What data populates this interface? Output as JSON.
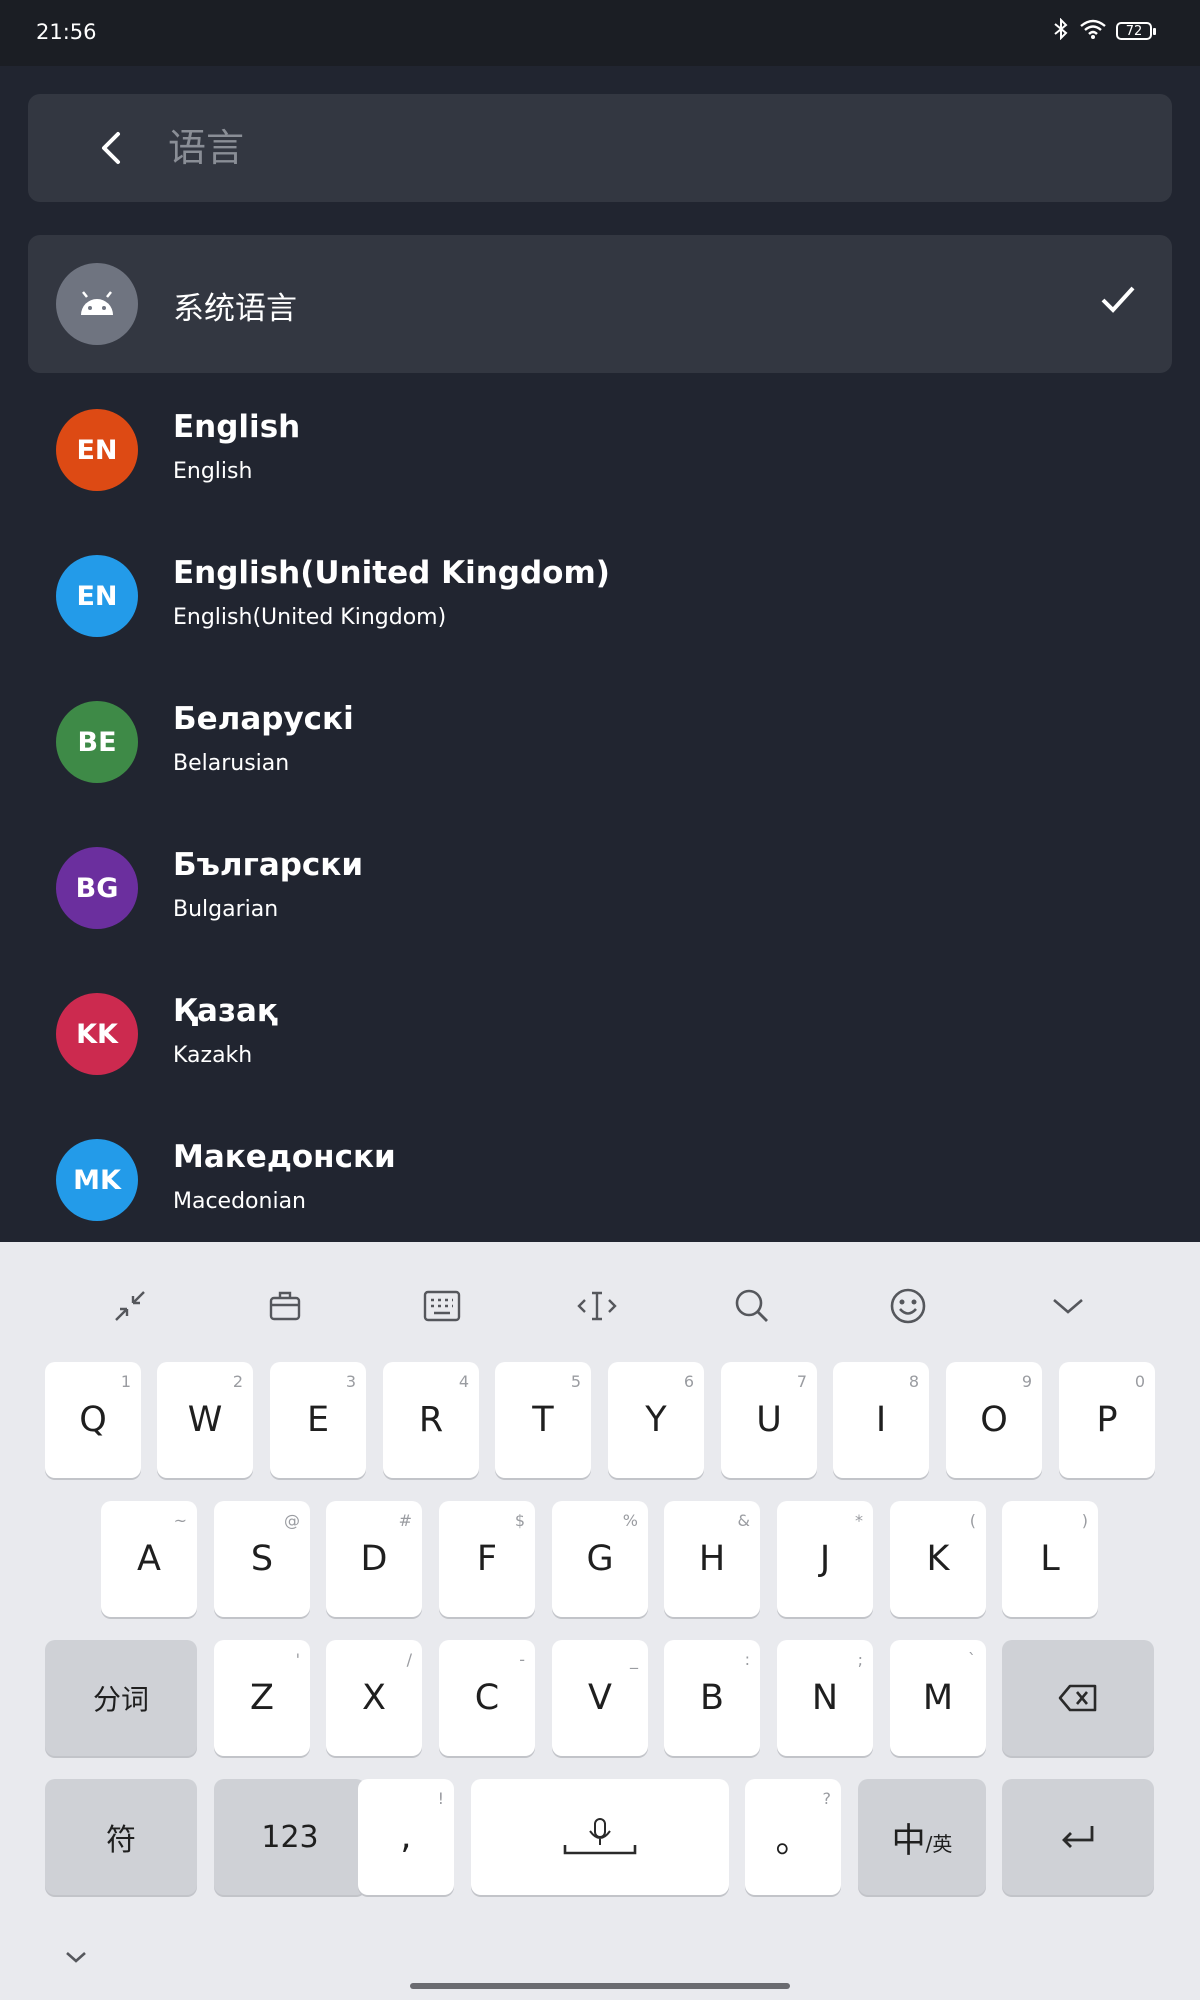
{
  "status_bar": {
    "time": "21:56",
    "battery": "72"
  },
  "search": {
    "query": "语言"
  },
  "languages": [
    {
      "title": "系统语言",
      "subtitle": "",
      "avatar_text": "",
      "avatar_color": "#6f7480",
      "selected": true
    },
    {
      "title": "English",
      "subtitle": "English",
      "avatar_text": "EN",
      "avatar_color": "#dd4a14"
    },
    {
      "title": "English(United Kingdom)",
      "subtitle": "English(United Kingdom)",
      "avatar_text": "EN",
      "avatar_color": "#239be9"
    },
    {
      "title": "Беларускі",
      "subtitle": "Belarusian",
      "avatar_text": "BE",
      "avatar_color": "#3e8a47"
    },
    {
      "title": "Български",
      "subtitle": "Bulgarian",
      "avatar_text": "BG",
      "avatar_color": "#6b2f9e"
    },
    {
      "title": "Қазақ",
      "subtitle": "Kazakh",
      "avatar_text": "KK",
      "avatar_color": "#cc2a4f"
    },
    {
      "title": "Македонски",
      "subtitle": "Macedonian",
      "avatar_text": "MK",
      "avatar_color": "#239be9"
    }
  ],
  "keyboard": {
    "toolbar": [
      "shrink-icon",
      "clipboard-icon",
      "keyboard-layout-icon",
      "cursor-icon",
      "search-icon",
      "emoji-icon",
      "hide-keyboard-icon"
    ],
    "row1": [
      {
        "k": "Q",
        "s": "1"
      },
      {
        "k": "W",
        "s": "2"
      },
      {
        "k": "E",
        "s": "3"
      },
      {
        "k": "R",
        "s": "4"
      },
      {
        "k": "T",
        "s": "5"
      },
      {
        "k": "Y",
        "s": "6"
      },
      {
        "k": "U",
        "s": "7"
      },
      {
        "k": "I",
        "s": "8"
      },
      {
        "k": "O",
        "s": "9"
      },
      {
        "k": "P",
        "s": "0"
      }
    ],
    "row2": [
      {
        "k": "A",
        "s": "~"
      },
      {
        "k": "S",
        "s": "@"
      },
      {
        "k": "D",
        "s": "#"
      },
      {
        "k": "F",
        "s": "$"
      },
      {
        "k": "G",
        "s": "%"
      },
      {
        "k": "H",
        "s": "&"
      },
      {
        "k": "J",
        "s": "*"
      },
      {
        "k": "K",
        "s": "("
      },
      {
        "k": "L",
        "s": ")"
      }
    ],
    "row3_left": "分词",
    "row3": [
      {
        "k": "Z",
        "s": "'"
      },
      {
        "k": "X",
        "s": "/"
      },
      {
        "k": "C",
        "s": "-"
      },
      {
        "k": "V",
        "s": "_"
      },
      {
        "k": "B",
        "s": ":"
      },
      {
        "k": "N",
        "s": ";"
      },
      {
        "k": "M",
        "s": "`"
      }
    ],
    "symbols": "符",
    "numbers": "123",
    "comma": {
      "k": ",",
      "s": "!"
    },
    "period": {
      "k": "。",
      "s": "?"
    },
    "lang_main": "中",
    "lang_sub": "/英"
  }
}
